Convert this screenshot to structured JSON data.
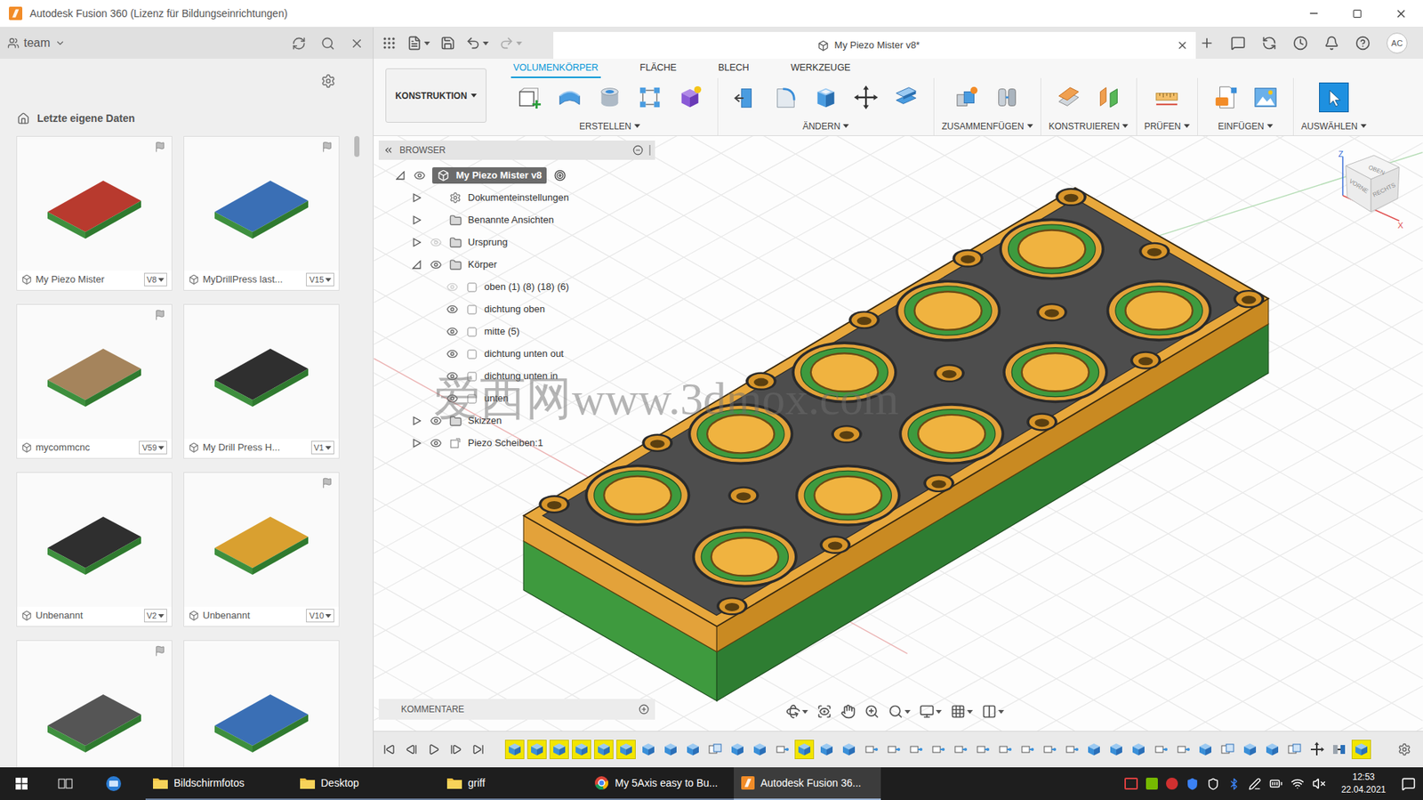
{
  "window": {
    "title": "Autodesk Fusion 360 (Lizenz für Bildungseinrichtungen)"
  },
  "data_panel": {
    "project": "team",
    "breadcrumb": "Letzte eigene Daten",
    "files": [
      {
        "name": "My Piezo Mister",
        "version": "V8",
        "flagged": true,
        "color": "#b83a2e"
      },
      {
        "name": "MyDrillPress last...",
        "version": "V15",
        "flagged": true,
        "color": "#3a6fb5"
      },
      {
        "name": "mycommcnc",
        "version": "V59",
        "flagged": true,
        "color": "#a5845c"
      },
      {
        "name": "My Drill Press H...",
        "version": "V1",
        "flagged": false,
        "color": "#2f2f2f"
      },
      {
        "name": "Unbenannt",
        "version": "V2",
        "flagged": false,
        "color": "#2f2f2f"
      },
      {
        "name": "Unbenannt",
        "version": "V10",
        "flagged": true,
        "color": "#d9a030"
      }
    ],
    "partial_files": [
      {
        "flagged": true,
        "color": "#555555"
      },
      {
        "flagged": false,
        "color": "#3a6fb5"
      }
    ]
  },
  "document": {
    "title": "My Piezo Mister v8*"
  },
  "user": {
    "initials": "AC"
  },
  "ribbon": {
    "workspace": "KONSTRUKTION",
    "tabs": [
      {
        "label": "VOLUMENKÖRPER",
        "selected": true
      },
      {
        "label": "FLÄCHE",
        "selected": false
      },
      {
        "label": "BLECH",
        "selected": false
      },
      {
        "label": "WERKZEUGE",
        "selected": false
      }
    ],
    "groups": [
      {
        "label": "ERSTELLEN",
        "tools": [
          {
            "kind": "new-sketch",
            "selected": false
          },
          {
            "kind": "extrude",
            "selected": false
          },
          {
            "kind": "revolve",
            "selected": false
          },
          {
            "kind": "pattern",
            "selected": false
          },
          {
            "kind": "form",
            "selected": false
          }
        ]
      },
      {
        "label": "ÄNDERN",
        "tools": [
          {
            "kind": "presspull",
            "selected": false
          },
          {
            "kind": "fillet",
            "selected": false
          },
          {
            "kind": "shell",
            "selected": false
          },
          {
            "kind": "move",
            "selected": false
          },
          {
            "kind": "align",
            "selected": false
          }
        ]
      },
      {
        "label": "ZUSAMMENFÜGEN",
        "tools": [
          {
            "kind": "new-component",
            "selected": false
          },
          {
            "kind": "joint",
            "selected": false
          }
        ]
      },
      {
        "label": "KONSTRUIEREN",
        "tools": [
          {
            "kind": "offset-plane",
            "selected": false
          },
          {
            "kind": "midplane",
            "selected": false
          }
        ]
      },
      {
        "label": "PRÜFEN",
        "tools": [
          {
            "kind": "measure",
            "selected": false
          }
        ]
      },
      {
        "label": "EINFÜGEN",
        "tools": [
          {
            "kind": "insert-svg",
            "selected": false
          },
          {
            "kind": "canvas",
            "selected": false
          }
        ]
      },
      {
        "label": "AUSWÄHLEN",
        "tools": [
          {
            "kind": "select",
            "selected": true
          }
        ]
      }
    ]
  },
  "browser": {
    "title": "BROWSER",
    "nodes": [
      {
        "label": "My Piezo Mister v8",
        "depth": 0,
        "kind": "component",
        "expandable": true,
        "expanded": true,
        "visibility": "shown",
        "selected": true,
        "active": true
      },
      {
        "label": "Dokumenteinstellungen",
        "depth": 1,
        "kind": "settings",
        "expandable": true,
        "expanded": false,
        "visibility": "none",
        "selected": false,
        "active": false
      },
      {
        "label": "Benannte Ansichten",
        "depth": 1,
        "kind": "folder",
        "expandable": true,
        "expanded": false,
        "visibility": "none",
        "selected": false,
        "active": false
      },
      {
        "label": "Ursprung",
        "depth": 1,
        "kind": "folder",
        "expandable": true,
        "expanded": false,
        "visibility": "hidden",
        "selected": false,
        "active": false
      },
      {
        "label": "Körper",
        "depth": 1,
        "kind": "folder",
        "expandable": true,
        "expanded": true,
        "visibility": "shown",
        "selected": false,
        "active": false
      },
      {
        "label": "oben (1) (8) (18) (6)",
        "depth": 2,
        "kind": "body",
        "expandable": false,
        "expanded": false,
        "visibility": "hidden",
        "selected": false,
        "active": false
      },
      {
        "label": "dichtung oben",
        "depth": 2,
        "kind": "body",
        "expandable": false,
        "expanded": false,
        "visibility": "shown",
        "selected": false,
        "active": false
      },
      {
        "label": "mitte (5)",
        "depth": 2,
        "kind": "body",
        "expandable": false,
        "expanded": false,
        "visibility": "shown",
        "selected": false,
        "active": false
      },
      {
        "label": "dichtung unten out",
        "depth": 2,
        "kind": "body",
        "expandable": false,
        "expanded": false,
        "visibility": "shown",
        "selected": false,
        "active": false
      },
      {
        "label": "dichtung unten in",
        "depth": 2,
        "kind": "body",
        "expandable": false,
        "expanded": false,
        "visibility": "shown",
        "selected": false,
        "active": false
      },
      {
        "label": "unten",
        "depth": 2,
        "kind": "body",
        "expandable": false,
        "expanded": false,
        "visibility": "shown",
        "selected": false,
        "active": false
      },
      {
        "label": "Skizzen",
        "depth": 1,
        "kind": "folder",
        "expandable": true,
        "expanded": false,
        "visibility": "shown",
        "selected": false,
        "active": false
      },
      {
        "label": "Piezo Scheiben:1",
        "depth": 1,
        "kind": "link",
        "expandable": true,
        "expanded": false,
        "visibility": "shown",
        "selected": false,
        "active": false
      }
    ]
  },
  "comments": {
    "label": "KOMMENTARE"
  },
  "view_cube": {
    "top": "OBEN",
    "front": "VORNE",
    "right": "RECHTS",
    "axes": [
      "Z",
      "X"
    ]
  },
  "watermark": "爱西网www.3dmox.com",
  "timeline": {
    "features": [
      {
        "kind": "extrude",
        "selected": true
      },
      {
        "kind": "extrude",
        "selected": true
      },
      {
        "kind": "extrude",
        "selected": true
      },
      {
        "kind": "extrude",
        "selected": true
      },
      {
        "kind": "extrude",
        "selected": true
      },
      {
        "kind": "extrude",
        "selected": true
      },
      {
        "kind": "extrude",
        "selected": false
      },
      {
        "kind": "extrude",
        "selected": false
      },
      {
        "kind": "extrude",
        "selected": false
      },
      {
        "kind": "combine",
        "selected": false
      },
      {
        "kind": "extrude",
        "selected": false
      },
      {
        "kind": "extrude",
        "selected": false
      },
      {
        "kind": "sketch",
        "selected": false
      },
      {
        "kind": "extrude",
        "selected": true
      },
      {
        "kind": "extrude",
        "selected": false
      },
      {
        "kind": "extrude",
        "selected": false
      },
      {
        "kind": "sketch",
        "selected": false
      },
      {
        "kind": "sketch",
        "selected": false
      },
      {
        "kind": "sketch",
        "selected": false
      },
      {
        "kind": "sketch",
        "selected": false
      },
      {
        "kind": "sketch",
        "selected": false
      },
      {
        "kind": "sketch",
        "selected": false
      },
      {
        "kind": "sketch",
        "selected": false
      },
      {
        "kind": "sketch",
        "selected": false
      },
      {
        "kind": "sketch",
        "selected": false
      },
      {
        "kind": "sketch",
        "selected": false
      },
      {
        "kind": "extrude",
        "selected": false
      },
      {
        "kind": "extrude",
        "selected": false
      },
      {
        "kind": "extrude",
        "selected": false
      },
      {
        "kind": "sketch",
        "selected": false
      },
      {
        "kind": "sketch",
        "selected": false
      },
      {
        "kind": "extrude",
        "selected": false
      },
      {
        "kind": "combine",
        "selected": false
      },
      {
        "kind": "extrude",
        "selected": false
      },
      {
        "kind": "extrude",
        "selected": false
      },
      {
        "kind": "combine",
        "selected": false
      },
      {
        "kind": "move",
        "selected": false
      },
      {
        "kind": "joint",
        "selected": false
      },
      {
        "kind": "extrude",
        "selected": true
      }
    ]
  },
  "taskbar": {
    "items": [
      {
        "label": "Bildschirmfotos",
        "kind": "folder",
        "active": false
      },
      {
        "label": "Desktop",
        "kind": "folder",
        "active": false
      },
      {
        "label": "griff",
        "kind": "folder",
        "active": false
      },
      {
        "label": "My 5Axis easy to Bu...",
        "kind": "chrome",
        "active": false
      },
      {
        "label": "Autodesk Fusion 36...",
        "kind": "fusion",
        "active": true
      }
    ],
    "time": "12:53",
    "date": "22.04.2021"
  }
}
